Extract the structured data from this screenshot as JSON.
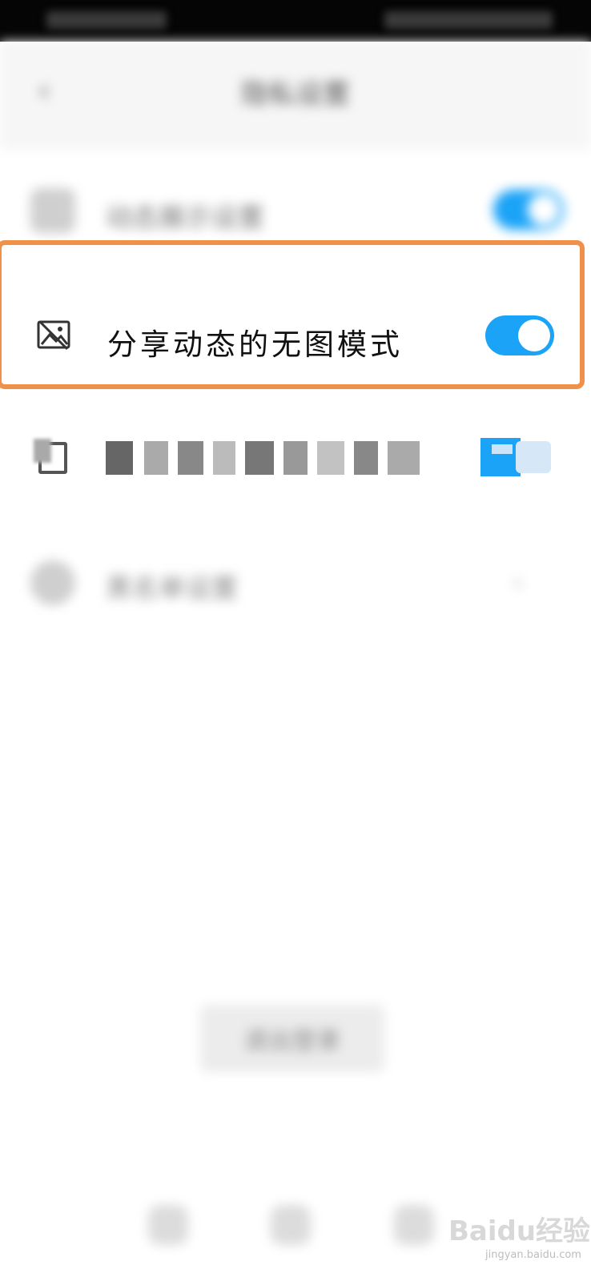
{
  "header": {
    "title": "隐私设置",
    "back_icon": "chevron-left-icon"
  },
  "settings": [
    {
      "label": "动态展示设置",
      "icon": "image-icon",
      "toggle_on": true
    },
    {
      "label": "分享动态的无图模式",
      "icon": "no-image-icon",
      "toggle_on": true
    },
    {
      "label": "",
      "icon": "document-icon",
      "toggle_on": true
    },
    {
      "label": "黑名单设置",
      "icon": "circle-icon"
    }
  ],
  "footer": {
    "button_label": "退出登录"
  },
  "watermark": {
    "text": "Baidu经验",
    "url": "jingyan.baidu.com"
  },
  "colors": {
    "toggle_on": "#1aa3f7",
    "highlight": "#f0914a"
  }
}
